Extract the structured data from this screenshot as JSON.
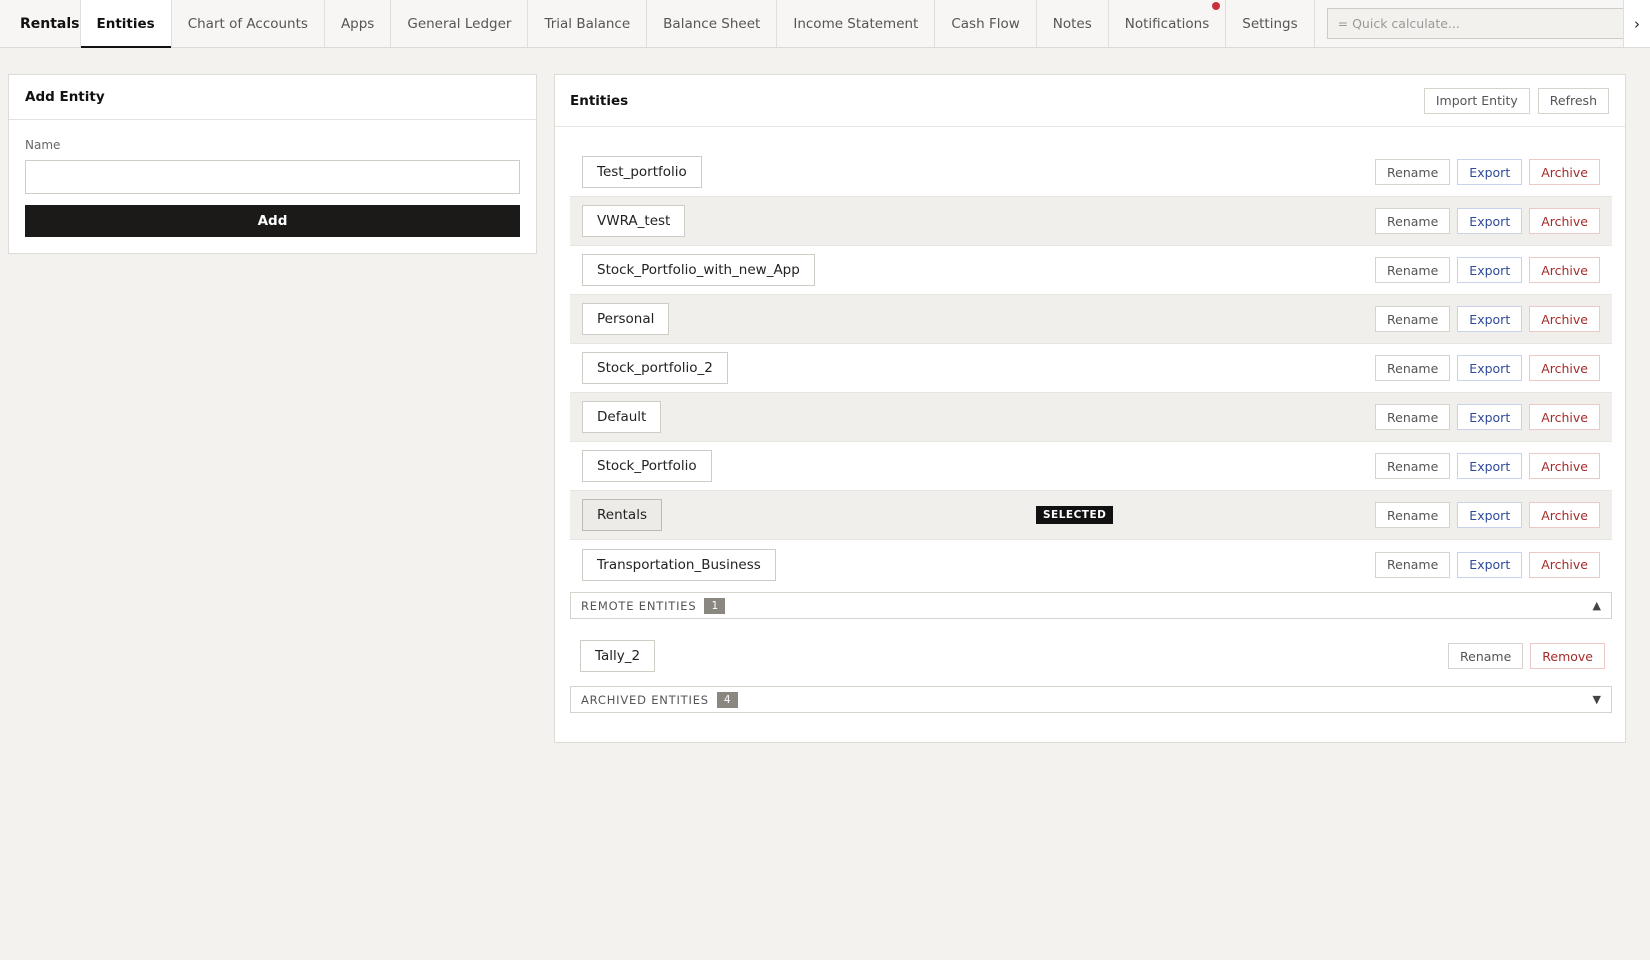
{
  "nav": {
    "brand": "Rentals",
    "tabs": [
      {
        "label": "Entities"
      },
      {
        "label": "Chart of Accounts"
      },
      {
        "label": "Apps"
      },
      {
        "label": "General Ledger"
      },
      {
        "label": "Trial Balance"
      },
      {
        "label": "Balance Sheet"
      },
      {
        "label": "Income Statement"
      },
      {
        "label": "Cash Flow"
      },
      {
        "label": "Notes"
      },
      {
        "label": "Notifications"
      },
      {
        "label": "Settings"
      }
    ],
    "quick_placeholder": "= Quick calculate...",
    "chevron": "›"
  },
  "add_entity": {
    "title": "Add Entity",
    "name_label": "Name",
    "name_value": "",
    "add_label": "Add"
  },
  "entities": {
    "title": "Entities",
    "import_label": "Import Entity",
    "refresh_label": "Refresh",
    "rename_label": "Rename",
    "export_label": "Export",
    "archive_label": "Archive",
    "selected_badge": "SELECTED",
    "items": [
      {
        "name": "Test_portfolio"
      },
      {
        "name": "VWRA_test"
      },
      {
        "name": "Stock_Portfolio_with_new_App"
      },
      {
        "name": "Personal"
      },
      {
        "name": "Stock_portfolio_2"
      },
      {
        "name": "Default"
      },
      {
        "name": "Stock_Portfolio"
      },
      {
        "name": "Rentals"
      },
      {
        "name": "Transportation_Business"
      }
    ]
  },
  "remote": {
    "label": "REMOTE ENTITIES",
    "count": "1",
    "arrow": "▲",
    "items": [
      {
        "name": "Tally_2"
      }
    ],
    "rename_label": "Rename",
    "remove_label": "Remove"
  },
  "archived": {
    "label": "ARCHIVED ENTITIES",
    "count": "4",
    "arrow": "▼"
  },
  "colors": {
    "accent_dark": "#1b1a18",
    "export_blue": "#2f4a9a",
    "archive_red": "#a52b2b",
    "notification_dot": "#c9303e"
  }
}
